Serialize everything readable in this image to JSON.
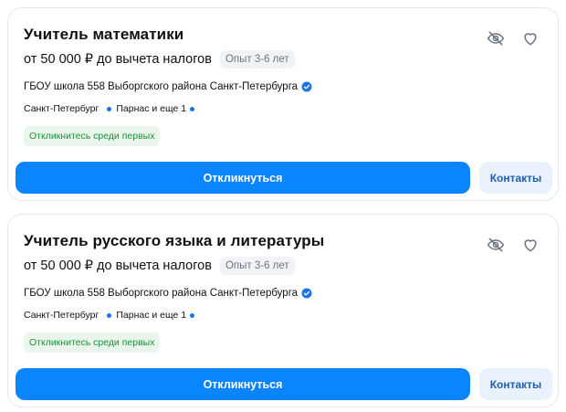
{
  "vacancies": [
    {
      "title": "Учитель математики",
      "salary": "от 50 000 ₽ до вычета налогов",
      "experience": "Опыт 3-6 лет",
      "company": "ГБОУ школа 558 Выборгского района Санкт-Петербурга",
      "city": "Санкт-Петербург",
      "metro": "Парнас и еще 1",
      "badge": "Откликнитесь среди первых",
      "respond_label": "Откликнуться",
      "contacts_label": "Контакты"
    },
    {
      "title": "Учитель русского языка и литературы",
      "salary": "от 50 000 ₽ до вычета налогов",
      "experience": "Опыт 3-6 лет",
      "company": "ГБОУ школа 558 Выборгского района Санкт-Петербурга",
      "city": "Санкт-Петербург",
      "metro": "Парнас и еще 1",
      "badge": "Откликнитесь среди первых",
      "respond_label": "Откликнуться",
      "contacts_label": "Контакты"
    }
  ],
  "icons": {
    "hide": "eye-off-icon",
    "favorite": "heart-icon",
    "verified": "verified-check-icon"
  },
  "colors": {
    "primary": "#0a84ff",
    "secondary_bg": "#e8f1fc",
    "badge_green_bg": "#eaf6ec",
    "badge_green_text": "#1f8f3a",
    "metro": "#1a73e8"
  }
}
